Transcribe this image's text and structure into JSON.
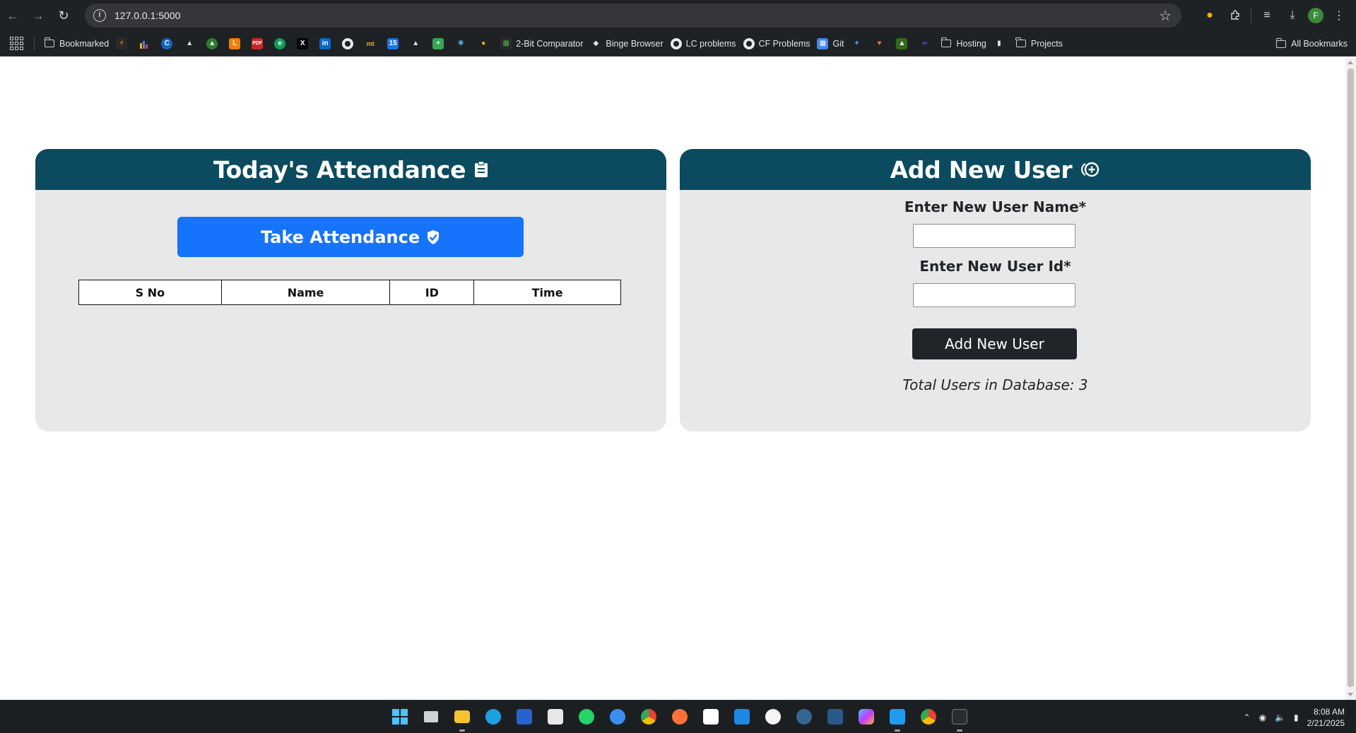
{
  "browser": {
    "url": "127.0.0.1:5000",
    "bookmarks": {
      "folder_bookmarked": "Bookmarked",
      "comparator": "2-Bit Comparator",
      "binge": "Binge Browser",
      "lc": "LC problems",
      "cf": "CF Problems",
      "git": "Git",
      "hosting": "Hosting",
      "projects": "Projects",
      "all": "All Bookmarks"
    },
    "profile_initial": "F"
  },
  "attendance": {
    "title": "Today's Attendance",
    "take_button": "Take Attendance",
    "table_headers": [
      "S No",
      "Name",
      "ID",
      "Time"
    ]
  },
  "add_user": {
    "title": "Add New User",
    "name_label": "Enter New User Name*",
    "id_label": "Enter New User Id*",
    "name_value": "",
    "id_value": "",
    "button": "Add New User",
    "total_text": "Total Users in Database: 3"
  },
  "taskbar": {
    "time": "8:08 AM",
    "date": "2/21/2025"
  },
  "colors": {
    "header_bg": "#0b4a5f",
    "primary_button": "#1673fb",
    "dark_button": "#212529",
    "card_bg": "#e8e8e8"
  }
}
